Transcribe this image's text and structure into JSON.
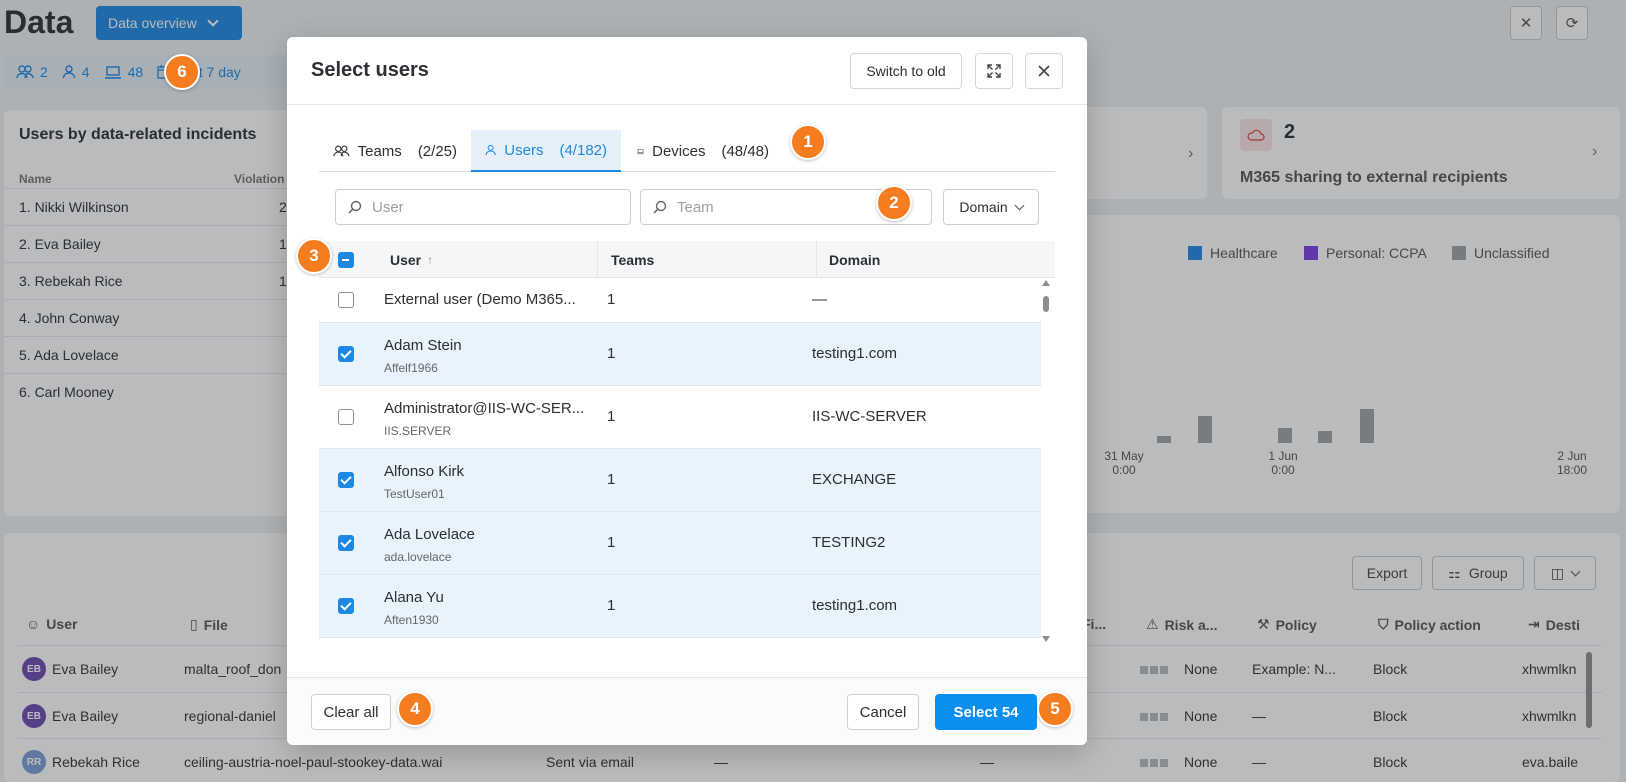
{
  "page": {
    "title": "Data",
    "overview_button": "Data overview",
    "filters": {
      "teams": "2",
      "users": "4",
      "devices": "48",
      "date": "Last 7 day"
    }
  },
  "users_card": {
    "title": "Users by data-related incidents",
    "col_name": "Name",
    "col_violations": "Violation",
    "rows": [
      {
        "name": "1. Nikki Wilkinson",
        "count": "2"
      },
      {
        "name": "2. Eva Bailey",
        "count": "1"
      },
      {
        "name": "3. Rebekah Rice",
        "count": "1"
      },
      {
        "name": "4. John Conway",
        "count": ""
      },
      {
        "name": "5. Ada Lovelace",
        "count": ""
      },
      {
        "name": "6. Carl Mooney",
        "count": ""
      }
    ]
  },
  "m365_card": {
    "count": "2",
    "label": "M365 sharing to external recipients"
  },
  "chart": {
    "legend": [
      {
        "name": "Healthcare",
        "color": "#1e88e5"
      },
      {
        "name": "Personal: CCPA",
        "color": "#7b3fe4"
      },
      {
        "name": "Unclassified",
        "color": "#a0a3a6"
      }
    ],
    "ticks": [
      {
        "l1": "31 May",
        "l2": "0:00"
      },
      {
        "l1": "1 Jun",
        "l2": "0:00"
      },
      {
        "l1": "2 Jun",
        "l2": "18:00"
      }
    ]
  },
  "table": {
    "buttons": {
      "export": "Export",
      "group": "Group"
    },
    "headers": {
      "user": "User",
      "file": "File",
      "fi": "Fi...",
      "risk": "Risk a...",
      "policy": "Policy",
      "policy_action": "Policy action",
      "dest": "Desti"
    },
    "rows": [
      {
        "initials": "EB",
        "color": "#6a4bb0",
        "user": "Eva Bailey",
        "file": "malta_roof_don",
        "channel": "",
        "dash1": "",
        "dash2": "",
        "risk": "None",
        "policy": "Example: N...",
        "action": "Block",
        "dest": "xhwmlkn"
      },
      {
        "initials": "EB",
        "color": "#6a4bb0",
        "user": "Eva Bailey",
        "file": "regional-daniel",
        "channel": "",
        "dash1": "",
        "dash2": "",
        "risk": "None",
        "policy": "—",
        "action": "Block",
        "dest": "xhwmlkn"
      },
      {
        "initials": "RR",
        "color": "#7a9ed6",
        "user": "Rebekah Rice",
        "file": "ceiling-austria-noel-paul-stookey-data.wai",
        "channel": "Sent via email",
        "dash1": "—",
        "dash2": "—",
        "risk": "None",
        "policy": "—",
        "action": "Block",
        "dest": "eva.baile"
      }
    ]
  },
  "modal": {
    "title": "Select users",
    "switch_label": "Switch to old",
    "tabs": [
      {
        "label": "Teams",
        "count": "(2/25)"
      },
      {
        "label": "Users",
        "count": "(4/182)"
      },
      {
        "label": "Devices",
        "count": "(48/48)"
      }
    ],
    "search_user_placeholder": "User",
    "search_team_placeholder": "Team",
    "domain_label": "Domain",
    "columns": {
      "user": "User",
      "teams": "Teams",
      "domain": "Domain"
    },
    "rows": [
      {
        "name": "External user (Demo M365...",
        "sub": "",
        "teams": "1",
        "domain": "—",
        "checked": false
      },
      {
        "name": "Adam Stein",
        "sub": "Affelf1966",
        "teams": "1",
        "domain": "testing1.com",
        "checked": true
      },
      {
        "name": "Administrator@IIS-WC-SER...",
        "sub": "IIS.SERVER",
        "teams": "1",
        "domain": "IIS-WC-SERVER",
        "checked": false
      },
      {
        "name": "Alfonso Kirk",
        "sub": "TestUser01",
        "teams": "1",
        "domain": "EXCHANGE",
        "checked": true
      },
      {
        "name": "Ada Lovelace",
        "sub": "ada.lovelace",
        "teams": "1",
        "domain": "TESTING2",
        "checked": true
      },
      {
        "name": "Alana Yu",
        "sub": "Aften1930",
        "teams": "1",
        "domain": "testing1.com",
        "checked": true
      }
    ],
    "clear_label": "Clear all",
    "cancel_label": "Cancel",
    "select_label": "Select 54"
  },
  "markers": [
    "1",
    "2",
    "3",
    "4",
    "5",
    "6"
  ],
  "colors": {
    "accent": "#1e88e5",
    "marker": "#f57c1f",
    "selected_row": "#e8f3fd"
  }
}
